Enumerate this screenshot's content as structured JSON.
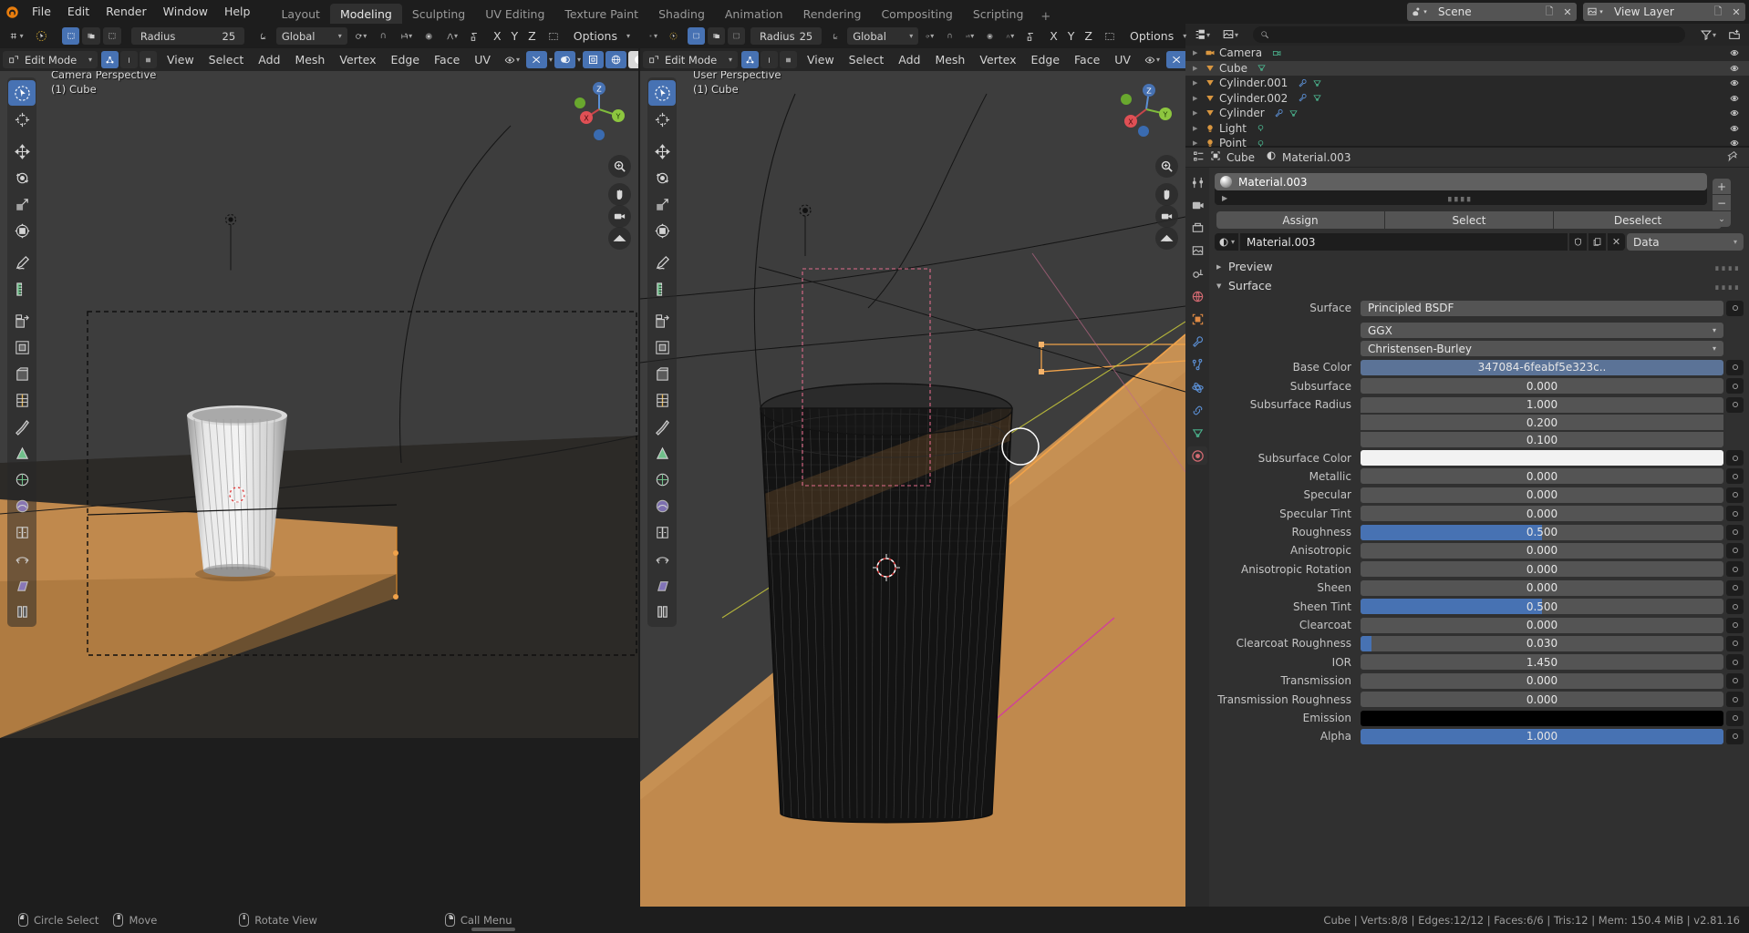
{
  "app": {
    "name": "Blender",
    "version_status": "Cube | Verts:8/8 | Edges:12/12 | Faces:6/6 | Tris:12 | Mem: 150.4 MiB | v2.81.16"
  },
  "topbar": {
    "menus": [
      "File",
      "Edit",
      "Render",
      "Window",
      "Help"
    ],
    "workspaces": [
      {
        "label": "Layout",
        "active": false
      },
      {
        "label": "Modeling",
        "active": true
      },
      {
        "label": "Sculpting",
        "active": false
      },
      {
        "label": "UV Editing",
        "active": false
      },
      {
        "label": "Texture Paint",
        "active": false
      },
      {
        "label": "Shading",
        "active": false
      },
      {
        "label": "Animation",
        "active": false
      },
      {
        "label": "Rendering",
        "active": false
      },
      {
        "label": "Compositing",
        "active": false
      },
      {
        "label": "Scripting",
        "active": false
      }
    ],
    "add_workspace": "+",
    "scene": {
      "label": "Scene",
      "icon": "scene-icon"
    },
    "view_layer": {
      "label": "View Layer",
      "icon": "view-layer-icon"
    }
  },
  "toolsettings": {
    "radius_label": "Radius",
    "radius_value": "25",
    "transform_orientation": "Global",
    "options_label": "Options",
    "axes": [
      "X",
      "Y",
      "Z"
    ]
  },
  "viewport_left": {
    "mode": "Edit Mode",
    "menus": [
      "View",
      "Select",
      "Add",
      "Mesh",
      "Vertex",
      "Edge",
      "Face",
      "UV"
    ],
    "view_name": "Camera Perspective",
    "collection_object": "(1) Cube"
  },
  "viewport_right": {
    "mode": "Edit Mode",
    "menus": [
      "View",
      "Select",
      "Add",
      "Mesh",
      "Vertex",
      "Edge",
      "Face",
      "UV"
    ],
    "view_name": "User Perspective",
    "collection_object": "(1) Cube"
  },
  "toolbar_tools": [
    {
      "name": "tweak-tool",
      "active": true
    },
    {
      "name": "cursor-tool",
      "active": false
    },
    {
      "name": "move-tool",
      "active": false
    },
    {
      "name": "rotate-tool",
      "active": false
    },
    {
      "name": "scale-tool",
      "active": false
    },
    {
      "name": "transform-tool",
      "active": false
    },
    {
      "name": "annotate-tool",
      "active": false
    },
    {
      "name": "measure-tool",
      "active": false
    },
    {
      "name": "extrude-region-tool",
      "active": false
    },
    {
      "name": "inset-faces-tool",
      "active": false
    },
    {
      "name": "bevel-tool",
      "active": false
    },
    {
      "name": "loop-cut-tool",
      "active": false
    },
    {
      "name": "knife-tool",
      "active": false
    },
    {
      "name": "poly-build-tool",
      "active": false
    },
    {
      "name": "spin-tool",
      "active": false
    },
    {
      "name": "smooth-tool",
      "active": false
    },
    {
      "name": "edge-slide-tool",
      "active": false
    },
    {
      "name": "shrink-fatten-tool",
      "active": false
    },
    {
      "name": "shear-tool",
      "active": false
    },
    {
      "name": "rip-region-tool",
      "active": false
    }
  ],
  "outliner": {
    "search_placeholder": "",
    "display_mode": "View Layer",
    "items": [
      {
        "label": "Camera",
        "icon": "camera-object-icon",
        "data_icon": "camera-data-icon",
        "selected": false
      },
      {
        "label": "Cube",
        "icon": "mesh-object-icon",
        "data_icon": "mesh-data-icon",
        "selected": true
      },
      {
        "label": "Cylinder.001",
        "icon": "mesh-object-icon",
        "data_icon": "mesh-data-icon",
        "modifier": true,
        "selected": false
      },
      {
        "label": "Cylinder.002",
        "icon": "mesh-object-icon",
        "data_icon": "mesh-data-icon",
        "modifier": true,
        "selected": false
      },
      {
        "label": "Cylinder",
        "icon": "mesh-object-icon",
        "data_icon": "mesh-data-icon",
        "modifier": true,
        "selected": false
      },
      {
        "label": "Light",
        "icon": "light-object-icon",
        "data_icon": "light-data-icon",
        "selected": false
      },
      {
        "label": "Point",
        "icon": "light-object-icon",
        "data_icon": "light-data-icon",
        "selected": false
      }
    ]
  },
  "properties": {
    "breadcrumb": {
      "object": "Cube",
      "material": "Material.003"
    },
    "material_slot": "Material.003",
    "slot_buttons": {
      "add": "+",
      "remove": "−",
      "menu": "⌄"
    },
    "assign_row": [
      "Assign",
      "Select",
      "Deselect"
    ],
    "material_id": {
      "name": "Material.003",
      "users_label": "Data"
    },
    "panels": [
      {
        "title": "Preview",
        "open": false
      },
      {
        "title": "Surface",
        "open": true
      }
    ],
    "surface_rows": [
      {
        "label": "Surface",
        "value": "Principled BSDF",
        "type": "dropdown_socket"
      },
      {
        "label": "",
        "value": "GGX",
        "type": "dropdown"
      },
      {
        "label": "",
        "value": "Christensen-Burley",
        "type": "dropdown"
      },
      {
        "label": "Base Color",
        "value": "347084-6feabf5e323c..",
        "type": "linked"
      },
      {
        "label": "Subsurface",
        "value": "0.000",
        "type": "slider",
        "fill": 0
      },
      {
        "label": "Subsurface Radius",
        "value": "1.000",
        "type": "value_multi"
      },
      {
        "label": "",
        "value": "0.200",
        "type": "value_multi_cont"
      },
      {
        "label": "",
        "value": "0.100",
        "type": "value_multi_cont"
      },
      {
        "label": "Subsurface Color",
        "value": "",
        "type": "color",
        "color": "#f2f2f2"
      },
      {
        "label": "Metallic",
        "value": "0.000",
        "type": "slider",
        "fill": 0
      },
      {
        "label": "Specular",
        "value": "0.000",
        "type": "slider",
        "fill": 0
      },
      {
        "label": "Specular Tint",
        "value": "0.000",
        "type": "slider",
        "fill": 0
      },
      {
        "label": "Roughness",
        "value": "0.500",
        "type": "slider",
        "fill": 50
      },
      {
        "label": "Anisotropic",
        "value": "0.000",
        "type": "slider",
        "fill": 0
      },
      {
        "label": "Anisotropic Rotation",
        "value": "0.000",
        "type": "slider",
        "fill": 0
      },
      {
        "label": "Sheen",
        "value": "0.000",
        "type": "slider",
        "fill": 0
      },
      {
        "label": "Sheen Tint",
        "value": "0.500",
        "type": "slider",
        "fill": 50
      },
      {
        "label": "Clearcoat",
        "value": "0.000",
        "type": "slider",
        "fill": 0
      },
      {
        "label": "Clearcoat Roughness",
        "value": "0.030",
        "type": "slider",
        "fill": 3
      },
      {
        "label": "IOR",
        "value": "1.450",
        "type": "slider",
        "fill": 0
      },
      {
        "label": "Transmission",
        "value": "0.000",
        "type": "slider",
        "fill": 0
      },
      {
        "label": "Transmission Roughness",
        "value": "0.000",
        "type": "slider",
        "fill": 0
      },
      {
        "label": "Emission",
        "value": "",
        "type": "color",
        "color": "#000000"
      },
      {
        "label": "Alpha",
        "value": "1.000",
        "type": "slider",
        "fill": 100
      }
    ],
    "tabs": [
      {
        "name": "tool-tab",
        "active": false
      },
      {
        "name": "render-tab",
        "active": false
      },
      {
        "name": "output-tab",
        "active": false
      },
      {
        "name": "view-layer-tab",
        "active": false
      },
      {
        "name": "scene-tab",
        "active": false
      },
      {
        "name": "world-tab",
        "active": false
      },
      {
        "name": "object-tab",
        "active": false
      },
      {
        "name": "modifier-tab",
        "active": false
      },
      {
        "name": "particles-tab",
        "active": false
      },
      {
        "name": "physics-tab",
        "active": false
      },
      {
        "name": "constraint-tab",
        "active": false
      },
      {
        "name": "data-tab",
        "active": false
      },
      {
        "name": "material-tab",
        "active": true
      }
    ]
  },
  "statusbar": {
    "items": [
      {
        "mouse": "lmb",
        "label": "Circle Select"
      },
      {
        "mouse": "mmb",
        "label": "Move"
      },
      {
        "mouse": "mmb",
        "label": "Rotate View"
      },
      {
        "mouse": "rmb",
        "label": "Call Menu"
      }
    ]
  },
  "colors": {
    "accent_blue": "#4772b3",
    "selected_orange": "#ed9e5c",
    "active_tab_bg": "#303030",
    "header_bg": "#252525",
    "panel_bg": "#303030",
    "window_bg": "#1d1d1d",
    "viewport_bg": "#3d3d3d",
    "table_wood": "#c08b4f"
  }
}
